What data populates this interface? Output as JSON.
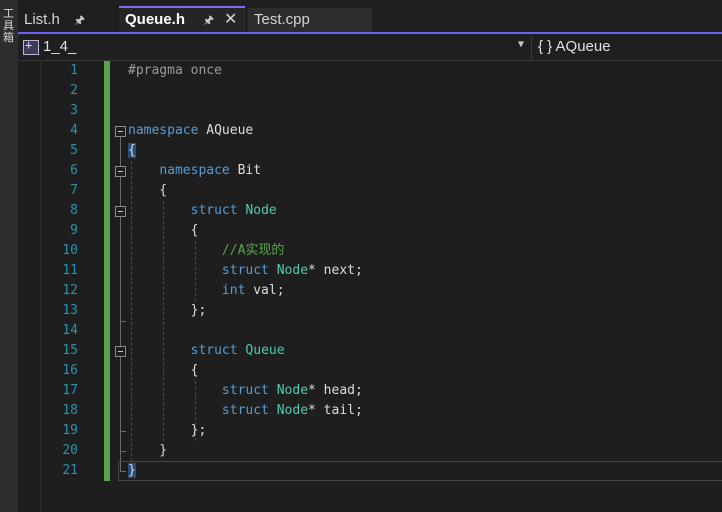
{
  "side_panel": {
    "label": "工具箱"
  },
  "tabs": [
    {
      "label": "List.h",
      "pinned": true,
      "active": false
    },
    {
      "label": "Queue.h",
      "pinned": true,
      "active": true,
      "closable": true
    },
    {
      "label": "Test.cpp",
      "pinned": false,
      "active": false
    }
  ],
  "nav": {
    "project": "1_4_",
    "scope": "{ } AQueue"
  },
  "code_lines": [
    {
      "n": "1",
      "segments": [
        {
          "t": "#pragma once",
          "c": "pp"
        }
      ]
    },
    {
      "n": "2",
      "segments": []
    },
    {
      "n": "3",
      "segments": []
    },
    {
      "n": "4",
      "segments": [
        {
          "t": "namespace",
          "c": "kw"
        },
        {
          "t": " AQueue",
          "c": ""
        }
      ]
    },
    {
      "n": "5",
      "segments": [
        {
          "t": "{",
          "c": "brace-hl"
        }
      ]
    },
    {
      "n": "6",
      "segments": [
        {
          "t": "    ",
          "c": ""
        },
        {
          "t": "namespace",
          "c": "kw"
        },
        {
          "t": " Bit",
          "c": ""
        }
      ]
    },
    {
      "n": "7",
      "segments": [
        {
          "t": "    {",
          "c": ""
        }
      ]
    },
    {
      "n": "8",
      "segments": [
        {
          "t": "        ",
          "c": ""
        },
        {
          "t": "struct",
          "c": "kw"
        },
        {
          "t": " ",
          "c": ""
        },
        {
          "t": "Node",
          "c": "type"
        }
      ]
    },
    {
      "n": "9",
      "segments": [
        {
          "t": "        {",
          "c": ""
        }
      ]
    },
    {
      "n": "10",
      "segments": [
        {
          "t": "            ",
          "c": ""
        },
        {
          "t": "//A实现的",
          "c": "cmt"
        }
      ]
    },
    {
      "n": "11",
      "segments": [
        {
          "t": "            ",
          "c": ""
        },
        {
          "t": "struct",
          "c": "kw"
        },
        {
          "t": " ",
          "c": ""
        },
        {
          "t": "Node",
          "c": "type"
        },
        {
          "t": "* next;",
          "c": ""
        }
      ]
    },
    {
      "n": "12",
      "segments": [
        {
          "t": "            ",
          "c": ""
        },
        {
          "t": "int",
          "c": "kw"
        },
        {
          "t": " val;",
          "c": ""
        }
      ]
    },
    {
      "n": "13",
      "segments": [
        {
          "t": "        };",
          "c": ""
        }
      ]
    },
    {
      "n": "14",
      "segments": []
    },
    {
      "n": "15",
      "segments": [
        {
          "t": "        ",
          "c": ""
        },
        {
          "t": "struct",
          "c": "kw"
        },
        {
          "t": " ",
          "c": ""
        },
        {
          "t": "Queue",
          "c": "type"
        }
      ]
    },
    {
      "n": "16",
      "segments": [
        {
          "t": "        {",
          "c": ""
        }
      ]
    },
    {
      "n": "17",
      "segments": [
        {
          "t": "            ",
          "c": ""
        },
        {
          "t": "struct",
          "c": "kw"
        },
        {
          "t": " ",
          "c": ""
        },
        {
          "t": "Node",
          "c": "type"
        },
        {
          "t": "* head;",
          "c": ""
        }
      ]
    },
    {
      "n": "18",
      "segments": [
        {
          "t": "            ",
          "c": ""
        },
        {
          "t": "struct",
          "c": "kw"
        },
        {
          "t": " ",
          "c": ""
        },
        {
          "t": "Node",
          "c": "type"
        },
        {
          "t": "* tail;",
          "c": ""
        }
      ]
    },
    {
      "n": "19",
      "segments": [
        {
          "t": "        };",
          "c": ""
        }
      ]
    },
    {
      "n": "20",
      "segments": [
        {
          "t": "    }",
          "c": ""
        }
      ]
    },
    {
      "n": "21",
      "segments": [
        {
          "t": "}",
          "c": "brace-hl"
        }
      ]
    }
  ],
  "colors": {
    "line_number": "#2b91af",
    "keyword": "#569cd6",
    "type": "#4ec9b0",
    "comment": "#57a64a",
    "change_bar": "#57a64a",
    "active_tab_accent": "#7b6df2"
  }
}
